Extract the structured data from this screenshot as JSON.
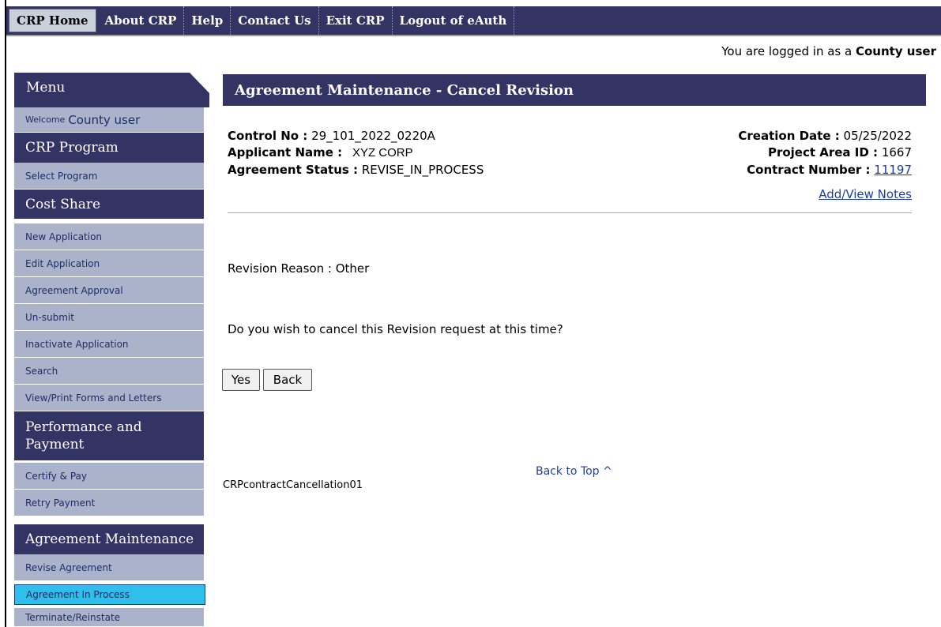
{
  "nav": {
    "tabs": [
      "CRP Home",
      "About CRP",
      "Help",
      "Contact Us",
      "Exit CRP",
      "Logout of eAuth"
    ]
  },
  "login": {
    "prefix": "You are logged in as a",
    "user": "County user"
  },
  "sidebar": {
    "menu_title": "Menu",
    "welcome_label": "Welcome",
    "welcome_user": "County user",
    "crp_program": "CRP Program",
    "select_program": "Select Program",
    "cost_share": "Cost Share",
    "cost_share_items": [
      "New Application",
      "Edit Application",
      "Agreement Approval",
      "Un-submit",
      "Inactivate Application",
      "Search",
      "View/Print Forms and Letters"
    ],
    "perf_pay_line1": "Performance and",
    "perf_pay_line2": "Payment",
    "perf_items": [
      "Certify & Pay",
      "Retry Payment"
    ],
    "agreement_maintenance": "Agreement Maintenance",
    "agreement_items": [
      "Revise Agreement",
      "Agreement In Process",
      "Terminate/Reinstate"
    ]
  },
  "main": {
    "title": "Agreement Maintenance - Cancel Revision",
    "control_no_label": "Control No :",
    "control_no": "29_101_2022_0220A",
    "applicant_label": "Applicant Name :",
    "applicant": "XYZ CORP",
    "status_label": "Agreement Status :",
    "status": "REVISE_IN_PROCESS",
    "creation_date_label": "Creation Date :",
    "creation_date": "05/25/2022",
    "project_area_label": "Project Area ID :",
    "project_area": "1667",
    "contract_number_label": "Contract Number :",
    "contract_number": "11197",
    "notes_link": "Add/View Notes",
    "revision_reason": "Revision Reason : Other",
    "question": "Do you wish to cancel this Revision request at this time?",
    "yes_label": "Yes",
    "back_label": "Back",
    "back_to_top": "Back to Top ^",
    "page_id": "CRPcontractCancellation01"
  }
}
